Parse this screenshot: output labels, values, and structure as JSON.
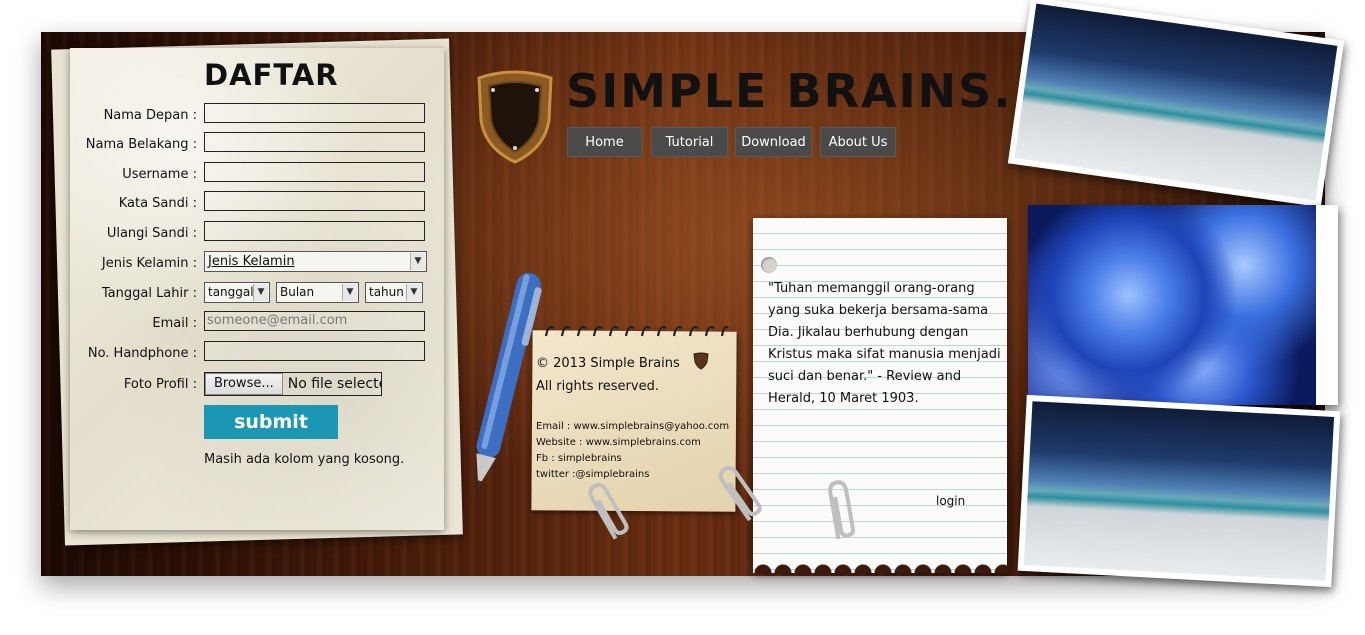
{
  "form": {
    "title": "DAFTAR",
    "fields": [
      {
        "label": "Nama Depan :",
        "value": ""
      },
      {
        "label": "Nama Belakang :",
        "value": ""
      },
      {
        "label": "Username :",
        "value": ""
      },
      {
        "label": "Kata Sandi :",
        "value": ""
      },
      {
        "label": "Ulangi Sandi :",
        "value": ""
      }
    ],
    "gender": {
      "label": "Jenis Kelamin :",
      "selected": "Jenis Kelamin"
    },
    "birthdate": {
      "label": "Tanggal Lahir :",
      "day": "tanggal",
      "month": "Bulan",
      "year": "tahun"
    },
    "email": {
      "label": "Email :",
      "placeholder": "someone@email.com"
    },
    "phone": {
      "label": "No. Handphone :",
      "value": ""
    },
    "photo": {
      "label": "Foto Profil :",
      "browse": "Browse...",
      "status": "No file selected."
    },
    "submit_label": "submit",
    "message": "Masih ada kolom yang kosong."
  },
  "header": {
    "site_title": "SIMPLE BRAINS.",
    "nav": [
      "Home",
      "Tutorial",
      "Download",
      "About Us"
    ]
  },
  "notepad": {
    "copyright": "© 2013 Simple Brains",
    "rights": "All rights reserved.",
    "email": "Email : www.simplebrains@yahoo.com",
    "website": "Website : www.simplebrains.com",
    "fb": "Fb : simplebrains",
    "twitter": "twitter :@simplebrains"
  },
  "note": {
    "quote": "\"Tuhan memanggil orang-orang yang suka bekerja bersama-sama Dia. Jikalau berhubung dengan Kristus maka sifat manusia menjadi suci dan benar.\" - Review and Herald, 10 Maret 1903.",
    "login_label": "login"
  },
  "colors": {
    "accent": "#1b97b4",
    "nav_bg": "#4a4a4a",
    "wood": "#6b2f12"
  }
}
